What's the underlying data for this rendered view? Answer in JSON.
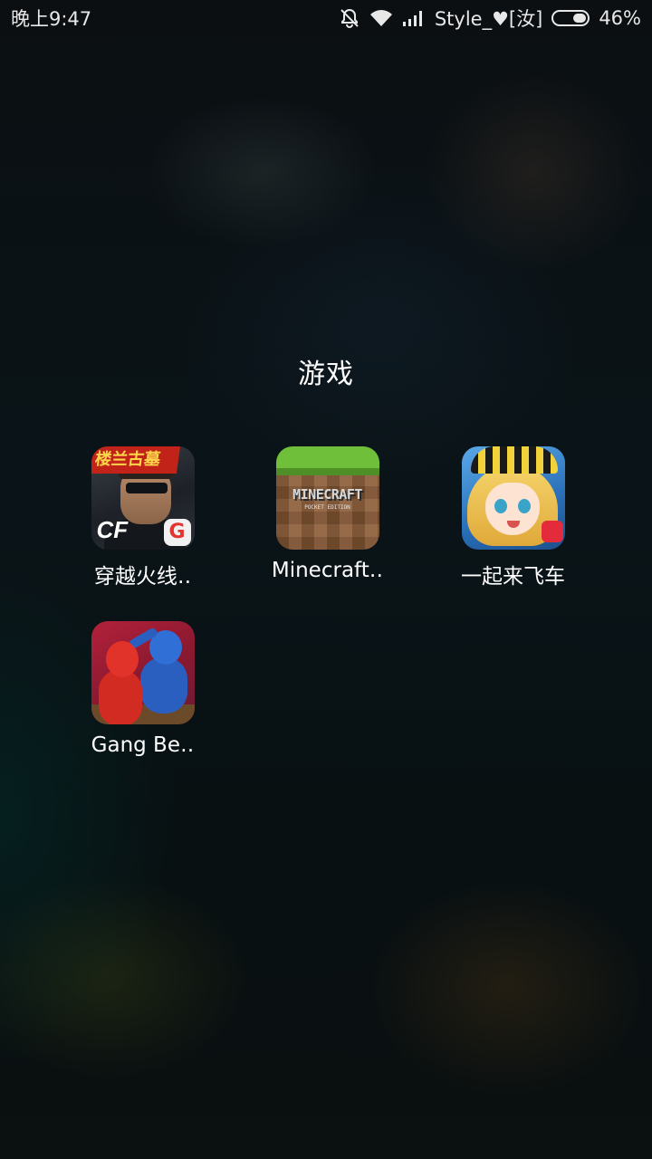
{
  "status_bar": {
    "time": "晚上9:47",
    "carrier": "Style_♥[汝]",
    "battery_percent": "46%",
    "battery_level": 0.46,
    "icons": [
      "alarm-off-icon",
      "wifi-icon",
      "signal-icon",
      "battery-icon"
    ]
  },
  "folder": {
    "title": "游戏",
    "apps": [
      {
        "label": "穿越火线‥",
        "icon": "crossfire-app-icon",
        "icon_text": "楼兰古墓",
        "logo": "CF",
        "badge": "G"
      },
      {
        "label": "Minecraft‥",
        "icon": "minecraft-app-icon",
        "icon_text": "MINECRAFT",
        "icon_subtext": "POCKET EDITION"
      },
      {
        "label": "一起来飞车",
        "icon": "racing-game-app-icon"
      },
      {
        "label": "Gang Be‥",
        "icon": "gang-beasts-app-icon"
      }
    ]
  }
}
